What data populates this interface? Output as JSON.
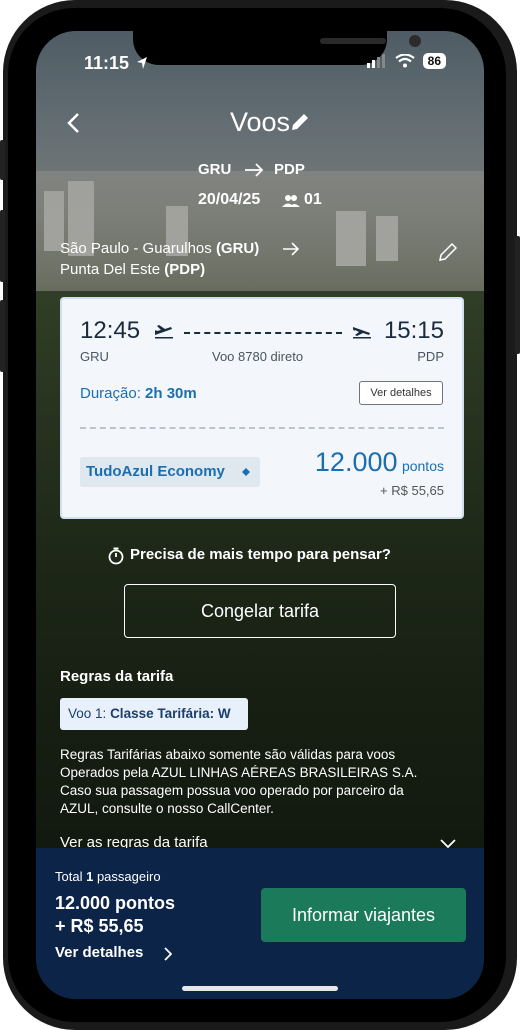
{
  "status_bar": {
    "time": "11:15",
    "battery": "86"
  },
  "header": {
    "title": "Voos"
  },
  "trip": {
    "origin_code": "GRU",
    "destination_code": "PDP",
    "date": "20/04/25",
    "passengers": "01"
  },
  "route": {
    "origin_name": "São Paulo - Guarulhos",
    "origin_code": "(GRU)",
    "destination_name": "Punta Del Este",
    "destination_code": "(PDP)"
  },
  "flight_card": {
    "departure_time": "12:45",
    "arrival_time": "15:15",
    "departure_code": "GRU",
    "arrival_code": "PDP",
    "flight_info": "Voo 8780 direto",
    "duration_label": "Duração:",
    "duration_value": "2h 30m",
    "details_button": "Ver detalhes",
    "fare_class": "TudoAzul Economy",
    "points_value": "12.000",
    "points_unit": "pontos",
    "cash_extra": "+ R$ 55,65"
  },
  "freeze": {
    "question": "Precisa de mais tempo para pensar?",
    "button": "Congelar tarifa"
  },
  "fare_rules": {
    "title": "Regras da tarifa",
    "tag_prefix": "Voo 1:",
    "tag_class": "Classe Tarifária: W",
    "text": "Regras Tarifárias abaixo somente são válidas para voos Operados pela AZUL LINHAS AÉREAS BRASILEIRAS S.A. Caso sua passagem possua voo operado por parceiro da AZUL, consulte o nosso CallCenter.",
    "link": "Ver as regras da tarifa"
  },
  "summary": {
    "total_label": "Total",
    "passenger_count": "1",
    "passenger_label": "passageiro",
    "points": "12.000 pontos",
    "cash": "+ R$ 55,65",
    "details_link": "Ver detalhes",
    "cta": "Informar viajantes"
  },
  "colors": {
    "accent_blue": "#1b6fb0",
    "cta_green": "#1a7a5a",
    "panel_navy": "#0b2448"
  }
}
